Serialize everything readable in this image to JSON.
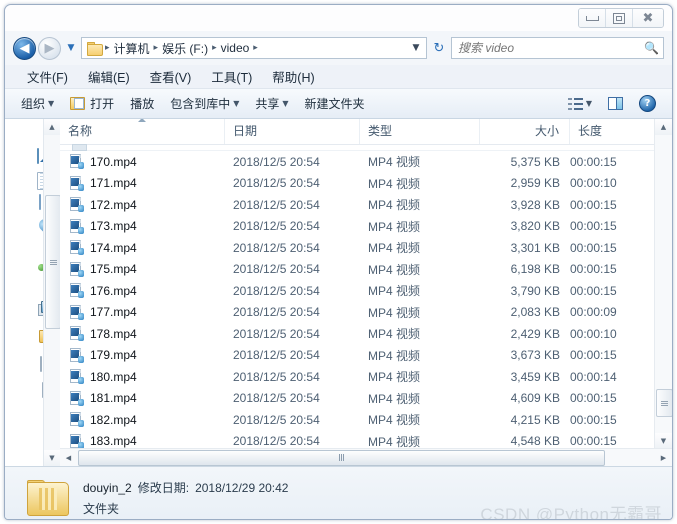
{
  "window": {
    "controls": {
      "minimize": "Minimize",
      "maximize": "Maximize",
      "close": "Close"
    }
  },
  "nav": {
    "back_label": "◀",
    "forward_label": "▶",
    "history_caret": "▼",
    "refresh_label": "↯",
    "breadcrumb": [
      "计算机",
      "娱乐 (F:)",
      "video"
    ],
    "breadcrumb_separator": "▸",
    "breadcrumb_caret": "▼"
  },
  "search": {
    "placeholder": "搜索 video",
    "value": "",
    "icon": "search-icon"
  },
  "menubar": {
    "items": [
      {
        "label": "文件(F)"
      },
      {
        "label": "编辑(E)"
      },
      {
        "label": "查看(V)"
      },
      {
        "label": "工具(T)"
      },
      {
        "label": "帮助(H)"
      }
    ]
  },
  "toolbar": {
    "organize": "组织",
    "open": "打开",
    "play": "播放",
    "include_in_library": "包含到库中",
    "share": "共享",
    "new_folder": "新建文件夹",
    "caret": "▼",
    "help_glyph": "?"
  },
  "columns": [
    {
      "key": "name",
      "label": "名称",
      "sorted": true,
      "sort_dir": "asc"
    },
    {
      "key": "date",
      "label": "日期",
      "sorted": false
    },
    {
      "key": "type",
      "label": "类型",
      "sorted": false
    },
    {
      "key": "size",
      "label": "大小",
      "sorted": false
    },
    {
      "key": "len",
      "label": "长度",
      "sorted": false
    }
  ],
  "files": [
    {
      "name": "170.mp4",
      "date": "2018/12/5 20:54",
      "type": "MP4 视频",
      "size": "5,375 KB",
      "length": "00:00:15"
    },
    {
      "name": "171.mp4",
      "date": "2018/12/5 20:54",
      "type": "MP4 视频",
      "size": "2,959 KB",
      "length": "00:00:10"
    },
    {
      "name": "172.mp4",
      "date": "2018/12/5 20:54",
      "type": "MP4 视频",
      "size": "3,928 KB",
      "length": "00:00:15"
    },
    {
      "name": "173.mp4",
      "date": "2018/12/5 20:54",
      "type": "MP4 视频",
      "size": "3,820 KB",
      "length": "00:00:15"
    },
    {
      "name": "174.mp4",
      "date": "2018/12/5 20:54",
      "type": "MP4 视频",
      "size": "3,301 KB",
      "length": "00:00:15"
    },
    {
      "name": "175.mp4",
      "date": "2018/12/5 20:54",
      "type": "MP4 视频",
      "size": "6,198 KB",
      "length": "00:00:15"
    },
    {
      "name": "176.mp4",
      "date": "2018/12/5 20:54",
      "type": "MP4 视频",
      "size": "3,790 KB",
      "length": "00:00:15"
    },
    {
      "name": "177.mp4",
      "date": "2018/12/5 20:54",
      "type": "MP4 视频",
      "size": "2,083 KB",
      "length": "00:00:09"
    },
    {
      "name": "178.mp4",
      "date": "2018/12/5 20:54",
      "type": "MP4 视频",
      "size": "2,429 KB",
      "length": "00:00:10"
    },
    {
      "name": "179.mp4",
      "date": "2018/12/5 20:54",
      "type": "MP4 视频",
      "size": "3,673 KB",
      "length": "00:00:15"
    },
    {
      "name": "180.mp4",
      "date": "2018/12/5 20:54",
      "type": "MP4 视频",
      "size": "3,459 KB",
      "length": "00:00:14"
    },
    {
      "name": "181.mp4",
      "date": "2018/12/5 20:54",
      "type": "MP4 视频",
      "size": "4,609 KB",
      "length": "00:00:15"
    },
    {
      "name": "182.mp4",
      "date": "2018/12/5 20:54",
      "type": "MP4 视频",
      "size": "4,215 KB",
      "length": "00:00:15"
    },
    {
      "name": "183.mp4",
      "date": "2018/12/5 20:54",
      "type": "MP4 视频",
      "size": "4,548 KB",
      "length": "00:00:15"
    }
  ],
  "navpane": {
    "icons": [
      "videos-icon",
      "pictures-icon",
      "documents-icon",
      "window-icon",
      "drop-icon",
      "network-icon",
      "computer-icon",
      "program-folder-icon",
      "disk-drive-icon",
      "disk-drive-icon",
      "disk-drive-icon",
      "network-globe-icon"
    ]
  },
  "scrollbars": {
    "up_arrow": "▲",
    "down_arrow": "▼",
    "left_arrow": "◀",
    "right_arrow": "▶"
  },
  "statusbar": {
    "folder_name": "douyin_2",
    "modified_label": "修改日期:",
    "modified_value": "2018/12/29 20:42",
    "kind": "文件夹",
    "icon": "folder-icon"
  },
  "watermark": {
    "text": "CSDN @Python无霸哥"
  }
}
